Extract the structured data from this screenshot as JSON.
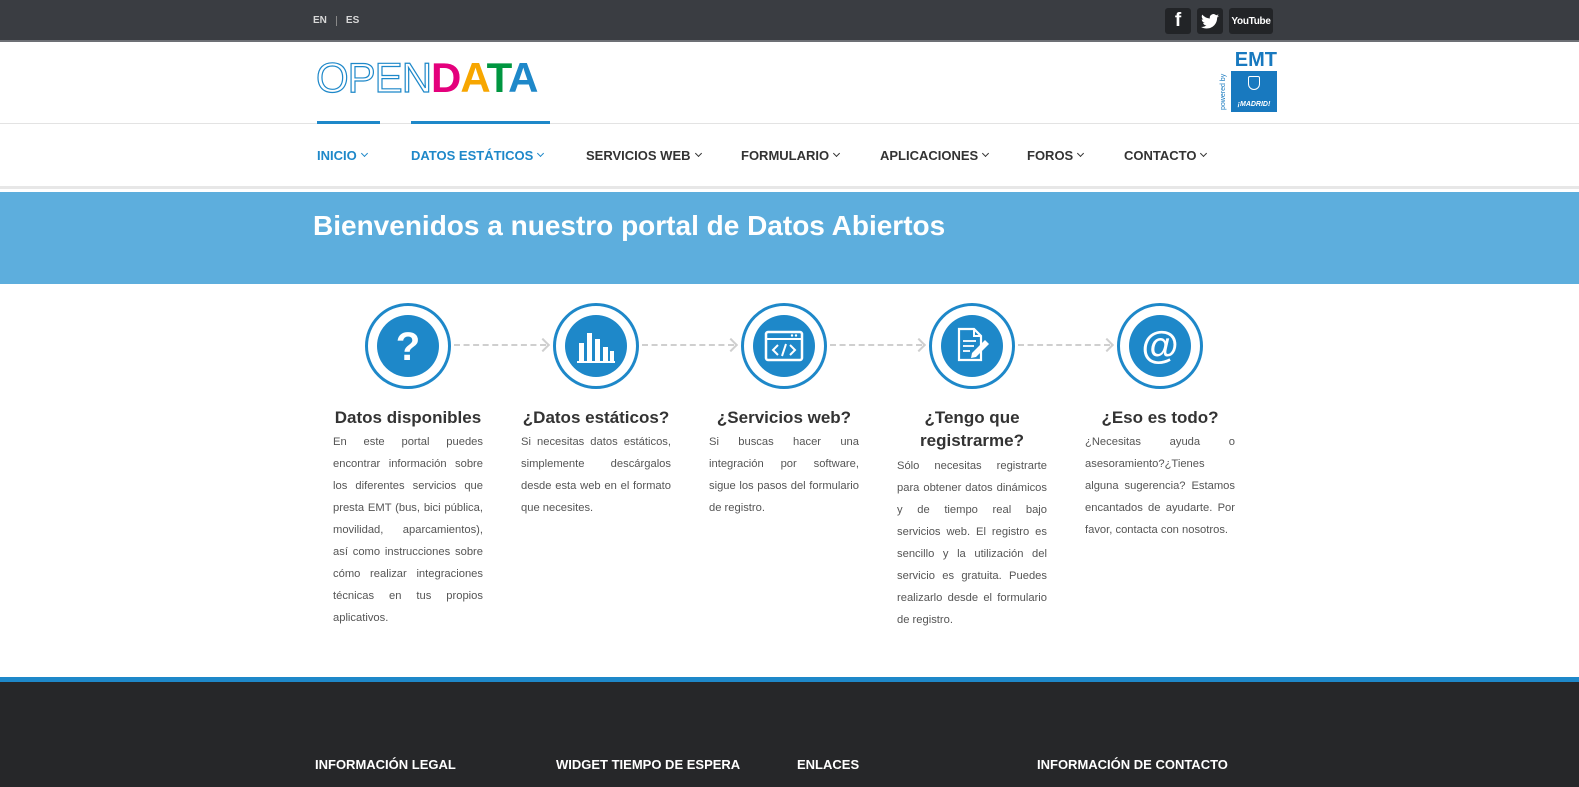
{
  "languages": [
    "EN",
    "ES"
  ],
  "social": {
    "facebook": "f",
    "youtube": "YouTube"
  },
  "logo": {
    "open": "OPEN",
    "data_letters": [
      {
        "char": "D",
        "color": "#e4007c"
      },
      {
        "char": "A",
        "color": "#f7a600"
      },
      {
        "char": "T",
        "color": "#009640"
      },
      {
        "char": "A",
        "color": "#1e88c9"
      }
    ]
  },
  "emt": {
    "name": "EMT",
    "powered": "powered by",
    "madrid": "¡MADRID!"
  },
  "nav": [
    {
      "label": "INICIO",
      "active": true
    },
    {
      "label": "DATOS ESTÁTICOS",
      "active": true
    },
    {
      "label": "SERVICIOS WEB",
      "active": false
    },
    {
      "label": "FORMULARIO",
      "active": false
    },
    {
      "label": "APLICACIONES",
      "active": false
    },
    {
      "label": "FOROS",
      "active": false
    },
    {
      "label": "CONTACTO",
      "active": false
    }
  ],
  "banner": {
    "title": "Bienvenidos a nuestro portal de Datos Abiertos"
  },
  "features": [
    {
      "icon": "question-icon",
      "title": "Datos disponibles",
      "text": "En este portal puedes encontrar información sobre los diferentes servicios que presta EMT (bus, bici pública, movilidad, aparcamientos), así como instrucciones sobre cómo realizar integraciones técnicas en tus propios aplicativos."
    },
    {
      "icon": "bar-chart-icon",
      "title": "¿Datos estáticos?",
      "text": "Si necesitas datos estáticos, simplemente descárgalos desde esta web en el formato que necesites."
    },
    {
      "icon": "code-window-icon",
      "title": "¿Servicios web?",
      "text": "Si buscas hacer una integración por software, sigue los pasos del formulario de registro."
    },
    {
      "icon": "document-pen-icon",
      "title": "¿Tengo que registrarme?",
      "text": "Sólo necesitas registrarte para obtener datos dinámicos y de tiempo real bajo servicios web. El registro es sencillo y la utilización del servicio es gratuita. Puedes realizarlo desde el formulario de registro."
    },
    {
      "icon": "at-sign-icon",
      "title": "¿Eso es todo?",
      "text": "¿Necesitas ayuda o asesoramiento?¿Tienes alguna sugerencia? Estamos encantados de ayudarte. Por favor, contacta con nosotros."
    }
  ],
  "footer": {
    "headings": [
      "INFORMACIÓN LEGAL",
      "WIDGET TIEMPO DE ESPERA",
      "ENLACES",
      "INFORMACIÓN DE CONTACTO"
    ]
  },
  "colors": {
    "accent": "#1e88c9",
    "banner": "#5daedd",
    "topbar": "#3a3d42",
    "footer": "#262729"
  }
}
